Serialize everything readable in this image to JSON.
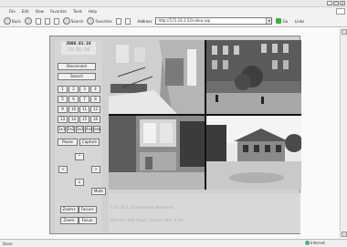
{
  "window": {
    "minimize": "_",
    "maximize": "□",
    "close": "x"
  },
  "menu": [
    "File",
    "Edit",
    "View",
    "Favorites",
    "Tools",
    "Help"
  ],
  "toolbar": {
    "back_label": "Back",
    "search_label": "Search",
    "favorites_label": "Favorites",
    "address_label": "Address",
    "address_value": "http://172.16.1.52/video.asp",
    "go_label": "Go",
    "links_label": "Links"
  },
  "clock": {
    "date": "2008.01.16",
    "time": "23:31:34"
  },
  "controls": {
    "disconnect": "Disconnect",
    "search": "Search",
    "channels": [
      "1",
      "2",
      "3",
      "4",
      "5",
      "6",
      "7",
      "8",
      "9",
      "10",
      "11",
      "12",
      "13",
      "14",
      "15",
      "16"
    ],
    "layouts": [
      "1x1",
      "2x2",
      "3x3",
      "4x4",
      "seq"
    ],
    "pause": "Pause",
    "capture": "Capture",
    "mute": "Mute",
    "zoom_in": "Zoom+",
    "focus_in": "Focus+",
    "zoom_out": "Zoom-",
    "focus_out": "Focus-"
  },
  "status": {
    "network": "172.16.1.52 Network detected",
    "rate": "Bitrate: 846 Kbps, Frame rate: 8 fps,"
  },
  "statusbar": {
    "left": "Done",
    "zone": "Internet"
  }
}
